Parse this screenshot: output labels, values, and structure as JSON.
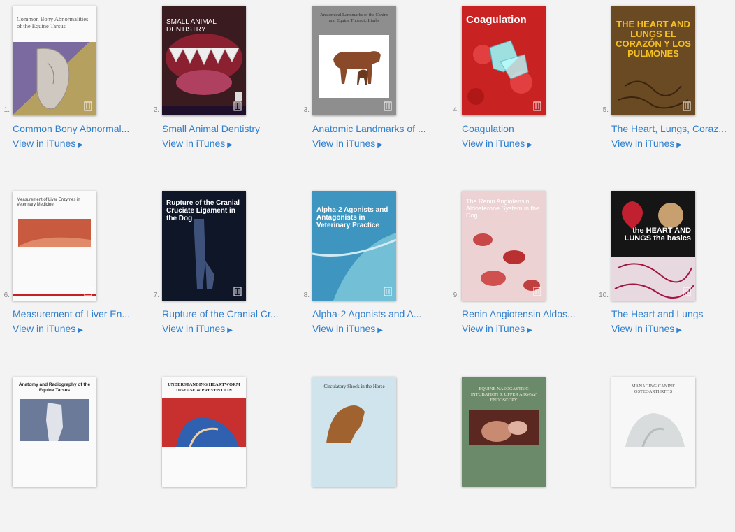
{
  "link_label": "View in iTunes",
  "books": [
    {
      "num": "1.",
      "title": "Common Bony Abnormal...",
      "cover_text": "Common Bony Abnormalities of the Equine Tarsus"
    },
    {
      "num": "2.",
      "title": "Small Animal Dentistry",
      "cover_text": "SMALL ANIMAL DENTISTRY"
    },
    {
      "num": "3.",
      "title": "Anatomic Landmarks of ...",
      "cover_text": "Anatomical Landmarks of the Canine and Equine Thoracic Limbs"
    },
    {
      "num": "4.",
      "title": "Coagulation",
      "cover_text": "Coagulation"
    },
    {
      "num": "5.",
      "title": "The Heart, Lungs, Coraz...",
      "cover_text": "THE HEART AND LUNGS EL CORAZÓN Y LOS PULMONES"
    },
    {
      "num": "6.",
      "title": "Measurement of Liver En...",
      "cover_text": "Measurement of Liver Enzymes in Veterinary Medicine"
    },
    {
      "num": "7.",
      "title": "Rupture of the Cranial Cr...",
      "cover_text": "Rupture of the Cranial Cruciate Ligament in the Dog"
    },
    {
      "num": "8.",
      "title": "Alpha-2 Agonists and A...",
      "cover_text": "Alpha-2 Agonists and Antagonists in Veterinary Practice"
    },
    {
      "num": "9.",
      "title": "Renin Angiotensin Aldos...",
      "cover_text": "The Renin Angiotensin Aldosterone System in the Dog"
    },
    {
      "num": "10.",
      "title": "The Heart and Lungs",
      "cover_text": "the HEART AND LUNGS the basics"
    },
    {
      "num": "",
      "title": "",
      "cover_text": "Anatomy and Radiography of the Equine Tarsus"
    },
    {
      "num": "",
      "title": "",
      "cover_text": "UNDERSTANDING HEARTWORM DISEASE & PREVENTION"
    },
    {
      "num": "",
      "title": "",
      "cover_text": "Circulatory Shock in the Horse"
    },
    {
      "num": "",
      "title": "",
      "cover_text": "EQUINE NASOGASTRIC INTUBATION & UPPER AIRWAY ENDOSCOPY"
    },
    {
      "num": "",
      "title": "",
      "cover_text": "MANAGING CANINE OSTEOARTHRITIS"
    }
  ]
}
